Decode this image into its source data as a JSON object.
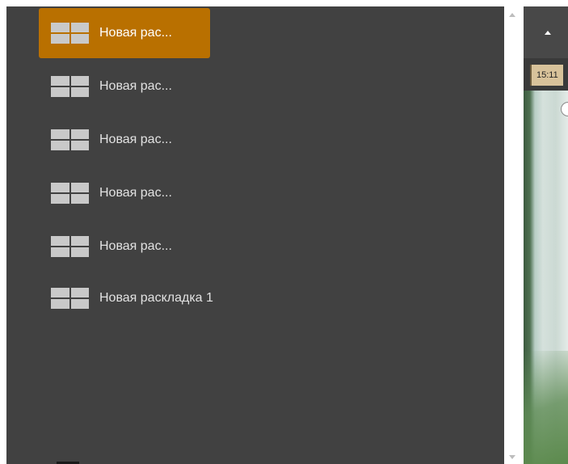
{
  "layout_list": {
    "items": [
      {
        "label": "Новая рас...",
        "selected": true
      },
      {
        "label": "Новая рас...",
        "selected": false
      },
      {
        "label": "Новая рас...",
        "selected": false
      },
      {
        "label": "Новая рас...",
        "selected": false
      },
      {
        "label": "Новая рас...",
        "selected": false
      },
      {
        "label": "Новая раскладка 1",
        "selected": false
      }
    ]
  },
  "background_app": {
    "time_label": "15:11"
  },
  "colors": {
    "panel_bg": "#414141",
    "selected_bg": "#b97000",
    "icon_fill": "#c9c9c9",
    "text": "#e2e2e2"
  },
  "icons": {
    "layout": "grid-layout-icon",
    "scroll_up": "triangle-up-icon",
    "scroll_down": "triangle-down-icon",
    "toolbar_collapse": "triangle-up-icon"
  }
}
